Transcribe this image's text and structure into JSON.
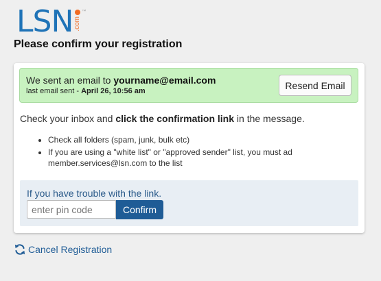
{
  "logo": {
    "text": "LSN",
    "com": ".com",
    "tm": "™"
  },
  "page_title": "Please confirm your registration",
  "alert": {
    "sent_prefix": "We sent an email to ",
    "email": "yourname@email.com",
    "last_sent_prefix": "last email sent - ",
    "last_sent_time": "April 26, 10:56 am",
    "resend_label": "Resend Email"
  },
  "instructions": {
    "prefix": "Check your inbox and ",
    "bold": "click the confirmation link",
    "suffix": " in the message."
  },
  "tips": [
    "Check all folders (spam, junk, bulk etc)",
    "If you are using a \"white list\" or \"approved sender\" list, you must ad member.services@lsn.com to the list"
  ],
  "pin": {
    "label": "If you have trouble with the link.",
    "placeholder": "enter pin code",
    "value": "",
    "confirm_label": "Confirm"
  },
  "cancel_label": "Cancel Registration",
  "colors": {
    "brand_blue": "#1f73b7",
    "brand_orange": "#f26b21",
    "success_bg": "#c8f2c0",
    "link_blue": "#1f5c96",
    "pin_box_bg": "#e8eef4"
  },
  "icons": {
    "cancel": "refresh-icon"
  }
}
